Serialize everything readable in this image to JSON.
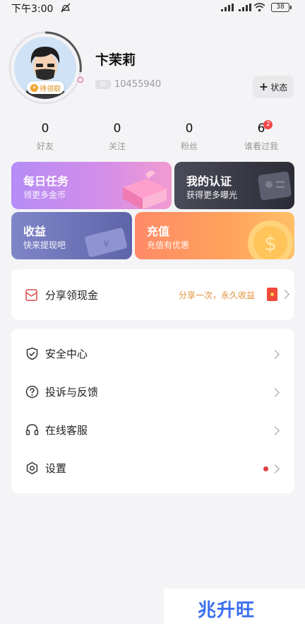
{
  "status_bar": {
    "time": "下午3:00",
    "battery": "38"
  },
  "profile": {
    "username": "卞茉莉",
    "uid": "10455940",
    "id_badge": "ID",
    "claim_badge": "待领取",
    "status_button": "状态"
  },
  "stats": [
    {
      "value": "0",
      "label": "好友"
    },
    {
      "value": "0",
      "label": "关注"
    },
    {
      "value": "0",
      "label": "粉丝"
    },
    {
      "value": "6",
      "label": "谁看过我",
      "badge": "2"
    }
  ],
  "cards": {
    "daily": {
      "title": "每日任务",
      "subtitle": "领更多金币"
    },
    "verify": {
      "title": "我的认证",
      "subtitle": "获得更多曝光"
    },
    "income": {
      "title": "收益",
      "subtitle": "快来提现吧"
    },
    "recharge": {
      "title": "充值",
      "subtitle": "充值有优惠"
    }
  },
  "share": {
    "label": "分享领现金",
    "hint": "分享一次，永久收益"
  },
  "menu": [
    {
      "label": "安全中心",
      "icon": "shield-icon"
    },
    {
      "label": "投诉与反馈",
      "icon": "question-icon"
    },
    {
      "label": "在线客服",
      "icon": "headset-icon"
    },
    {
      "label": "设置",
      "icon": "settings-icon",
      "has_dot": true
    }
  ],
  "watermark": {
    "text": "兆升旺"
  },
  "colors": {
    "background": "#f4f4f6",
    "accent_orange": "#e0913a",
    "badge_red": "#f04848",
    "brand_blue": "#3b6ff0"
  }
}
